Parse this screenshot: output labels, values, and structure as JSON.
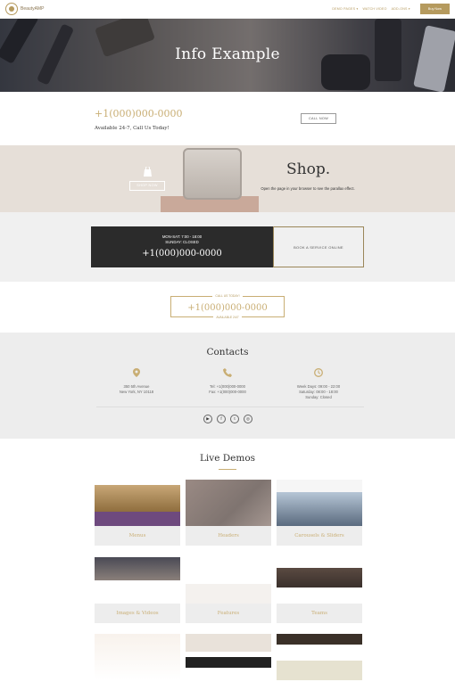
{
  "header": {
    "brand": "BeautyAMP",
    "nav": [
      "DEMO PAGES ▾",
      "WATCH VIDEO",
      "ADD-ONS ▾"
    ],
    "buy_label": "Buy Now",
    "accent": "#b59a5e"
  },
  "hero": {
    "title": "Info Example"
  },
  "call": {
    "phone": "+1(000)000-0000",
    "available": "Available 24-7, Call Us Today!",
    "button": "CALL NOW"
  },
  "shop": {
    "title": "Shop.",
    "subtitle": "Open the page in your browser to see the parallax effect.",
    "button": "SHOP NOW"
  },
  "booking": {
    "hours_line1": "MON-SAT: 7:00 - 18:00",
    "hours_line2": "SUNDAY: CLOSED",
    "phone": "+1(000)000-0000",
    "book_label": "BOOK A SERVICE ONLINE"
  },
  "call_today": {
    "top": "CALL US TODAY!",
    "phone": "+1(000)000-0000",
    "bottom": "AVAILABLE 24/7"
  },
  "contacts": {
    "title": "Contacts",
    "address": [
      "350 5th Avenue",
      "New York, NY 10118"
    ],
    "phones": [
      "Tel: +1(000)000-0000",
      "Fax: +1(000)000-0000"
    ],
    "hours": [
      "Week Days: 09:00 - 22:00",
      "Saturday: 08:00 - 18:00",
      "Sunday: Closed"
    ],
    "icons": [
      "map-pin-icon",
      "phone-icon",
      "clock-icon"
    ],
    "social": [
      "youtube-icon",
      "facebook-icon",
      "twitter-icon",
      "instagram-icon"
    ]
  },
  "demos": {
    "title": "Live Demos",
    "cards": [
      "Menus",
      "Headers",
      "Carousels & Sliders",
      "Images & Videos",
      "Features",
      "Teams",
      "",
      "",
      ""
    ]
  }
}
